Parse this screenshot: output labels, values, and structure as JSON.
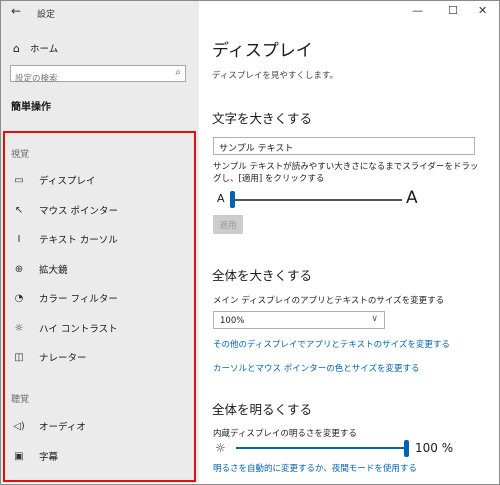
{
  "window": {
    "back_icon": "arrow-left-icon",
    "title": "設定",
    "controls": {
      "minimize": "—",
      "maximize": "☐",
      "close": "✕"
    }
  },
  "sidebar": {
    "home": "ホーム",
    "search_placeholder": "設定の検索",
    "section": "簡単操作",
    "groups": [
      {
        "label": "視覚",
        "items": [
          {
            "label": "ディスプレイ",
            "icon": "monitor-icon"
          },
          {
            "label": "マウス ポインター",
            "icon": "mouse-pointer-icon"
          },
          {
            "label": "テキスト カーソル",
            "icon": "text-cursor-icon"
          },
          {
            "label": "拡大鏡",
            "icon": "magnifier-icon"
          },
          {
            "label": "カラー フィルター",
            "icon": "color-filter-icon"
          },
          {
            "label": "ハイ コントラスト",
            "icon": "brightness-icon"
          },
          {
            "label": "ナレーター",
            "icon": "narrator-icon"
          }
        ]
      },
      {
        "label": "聴覚",
        "items": [
          {
            "label": "オーディオ",
            "icon": "speaker-icon"
          },
          {
            "label": "字幕",
            "icon": "captions-icon"
          }
        ]
      }
    ],
    "highlight_color": "#e01010"
  },
  "main": {
    "title": "ディスプレイ",
    "subtitle": "ディスプレイを見やすくします。",
    "text_size": {
      "heading": "文字を大きくする",
      "sample": "サンプル テキスト",
      "description": "サンプル テキストが読みやすい大きさになるまでスライダーをドラッグし、[適用] をクリックする",
      "small_a": "A",
      "large_a": "A",
      "slider_value_fraction": 0.0,
      "apply": "適用"
    },
    "everything_bigger": {
      "heading": "全体を大きくする",
      "label": "メイン ディスプレイのアプリとテキストのサイズを変更する",
      "selected": "100%",
      "link1": "その他のディスプレイでアプリとテキストのサイズを変更する",
      "link2": "カーソルとマウス ポインターの色とサイズを変更する"
    },
    "brightness": {
      "heading": "全体を明るくする",
      "label": "内蔵ディスプレイの明るさを変更する",
      "value": "100 %",
      "slider_value_fraction": 1.0,
      "link": "明るさを自動的に変更するか、夜間モードを使用する"
    }
  },
  "colors": {
    "accent": "#0063b1",
    "sidebar_bg": "#ebebeb"
  }
}
